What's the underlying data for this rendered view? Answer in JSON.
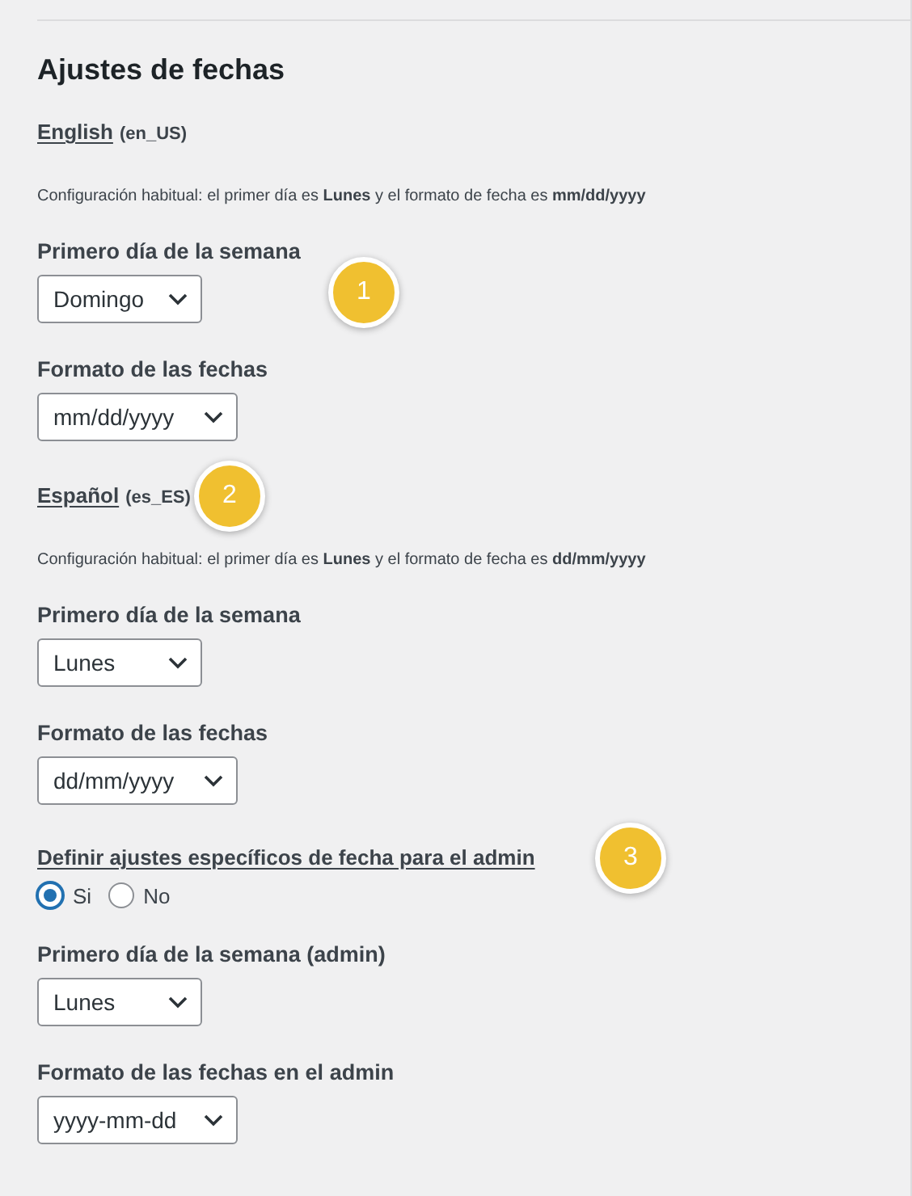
{
  "heading": "Ajustes de fechas",
  "locales": [
    {
      "name": "English",
      "code": "(en_US)",
      "note": "Configuración habitual: el primer día es **Lunes** y el formato de fecha es **mm/dd/yyyy**",
      "fields": [
        {
          "label": "Primero día de la semana",
          "value": "Domingo",
          "callout": "1"
        },
        {
          "label": "Formato de las fechas",
          "value": "mm/dd/yyyy"
        }
      ]
    },
    {
      "name": "Español",
      "code": "(es_ES)",
      "note": "Configuración habitual: el primer día es **Lunes** y el formato de fecha es **dd/mm/yyyy**",
      "callout": "2",
      "fields": [
        {
          "label": "Primero día de la semana",
          "value": "Lunes"
        },
        {
          "label": "Formato de las fechas",
          "value": "dd/mm/yyyy"
        }
      ]
    }
  ],
  "admin": {
    "label": "Definir ajustes específicos de fecha para el admin",
    "callout": "3",
    "options": [
      {
        "label": "Si",
        "selected": true
      },
      {
        "label": "No",
        "selected": false
      }
    ],
    "fields": [
      {
        "label": "Primero día de la semana (admin)",
        "value": "Lunes"
      },
      {
        "label": "Formato de las fechas en el admin",
        "value": "yyyy-mm-dd"
      }
    ]
  }
}
